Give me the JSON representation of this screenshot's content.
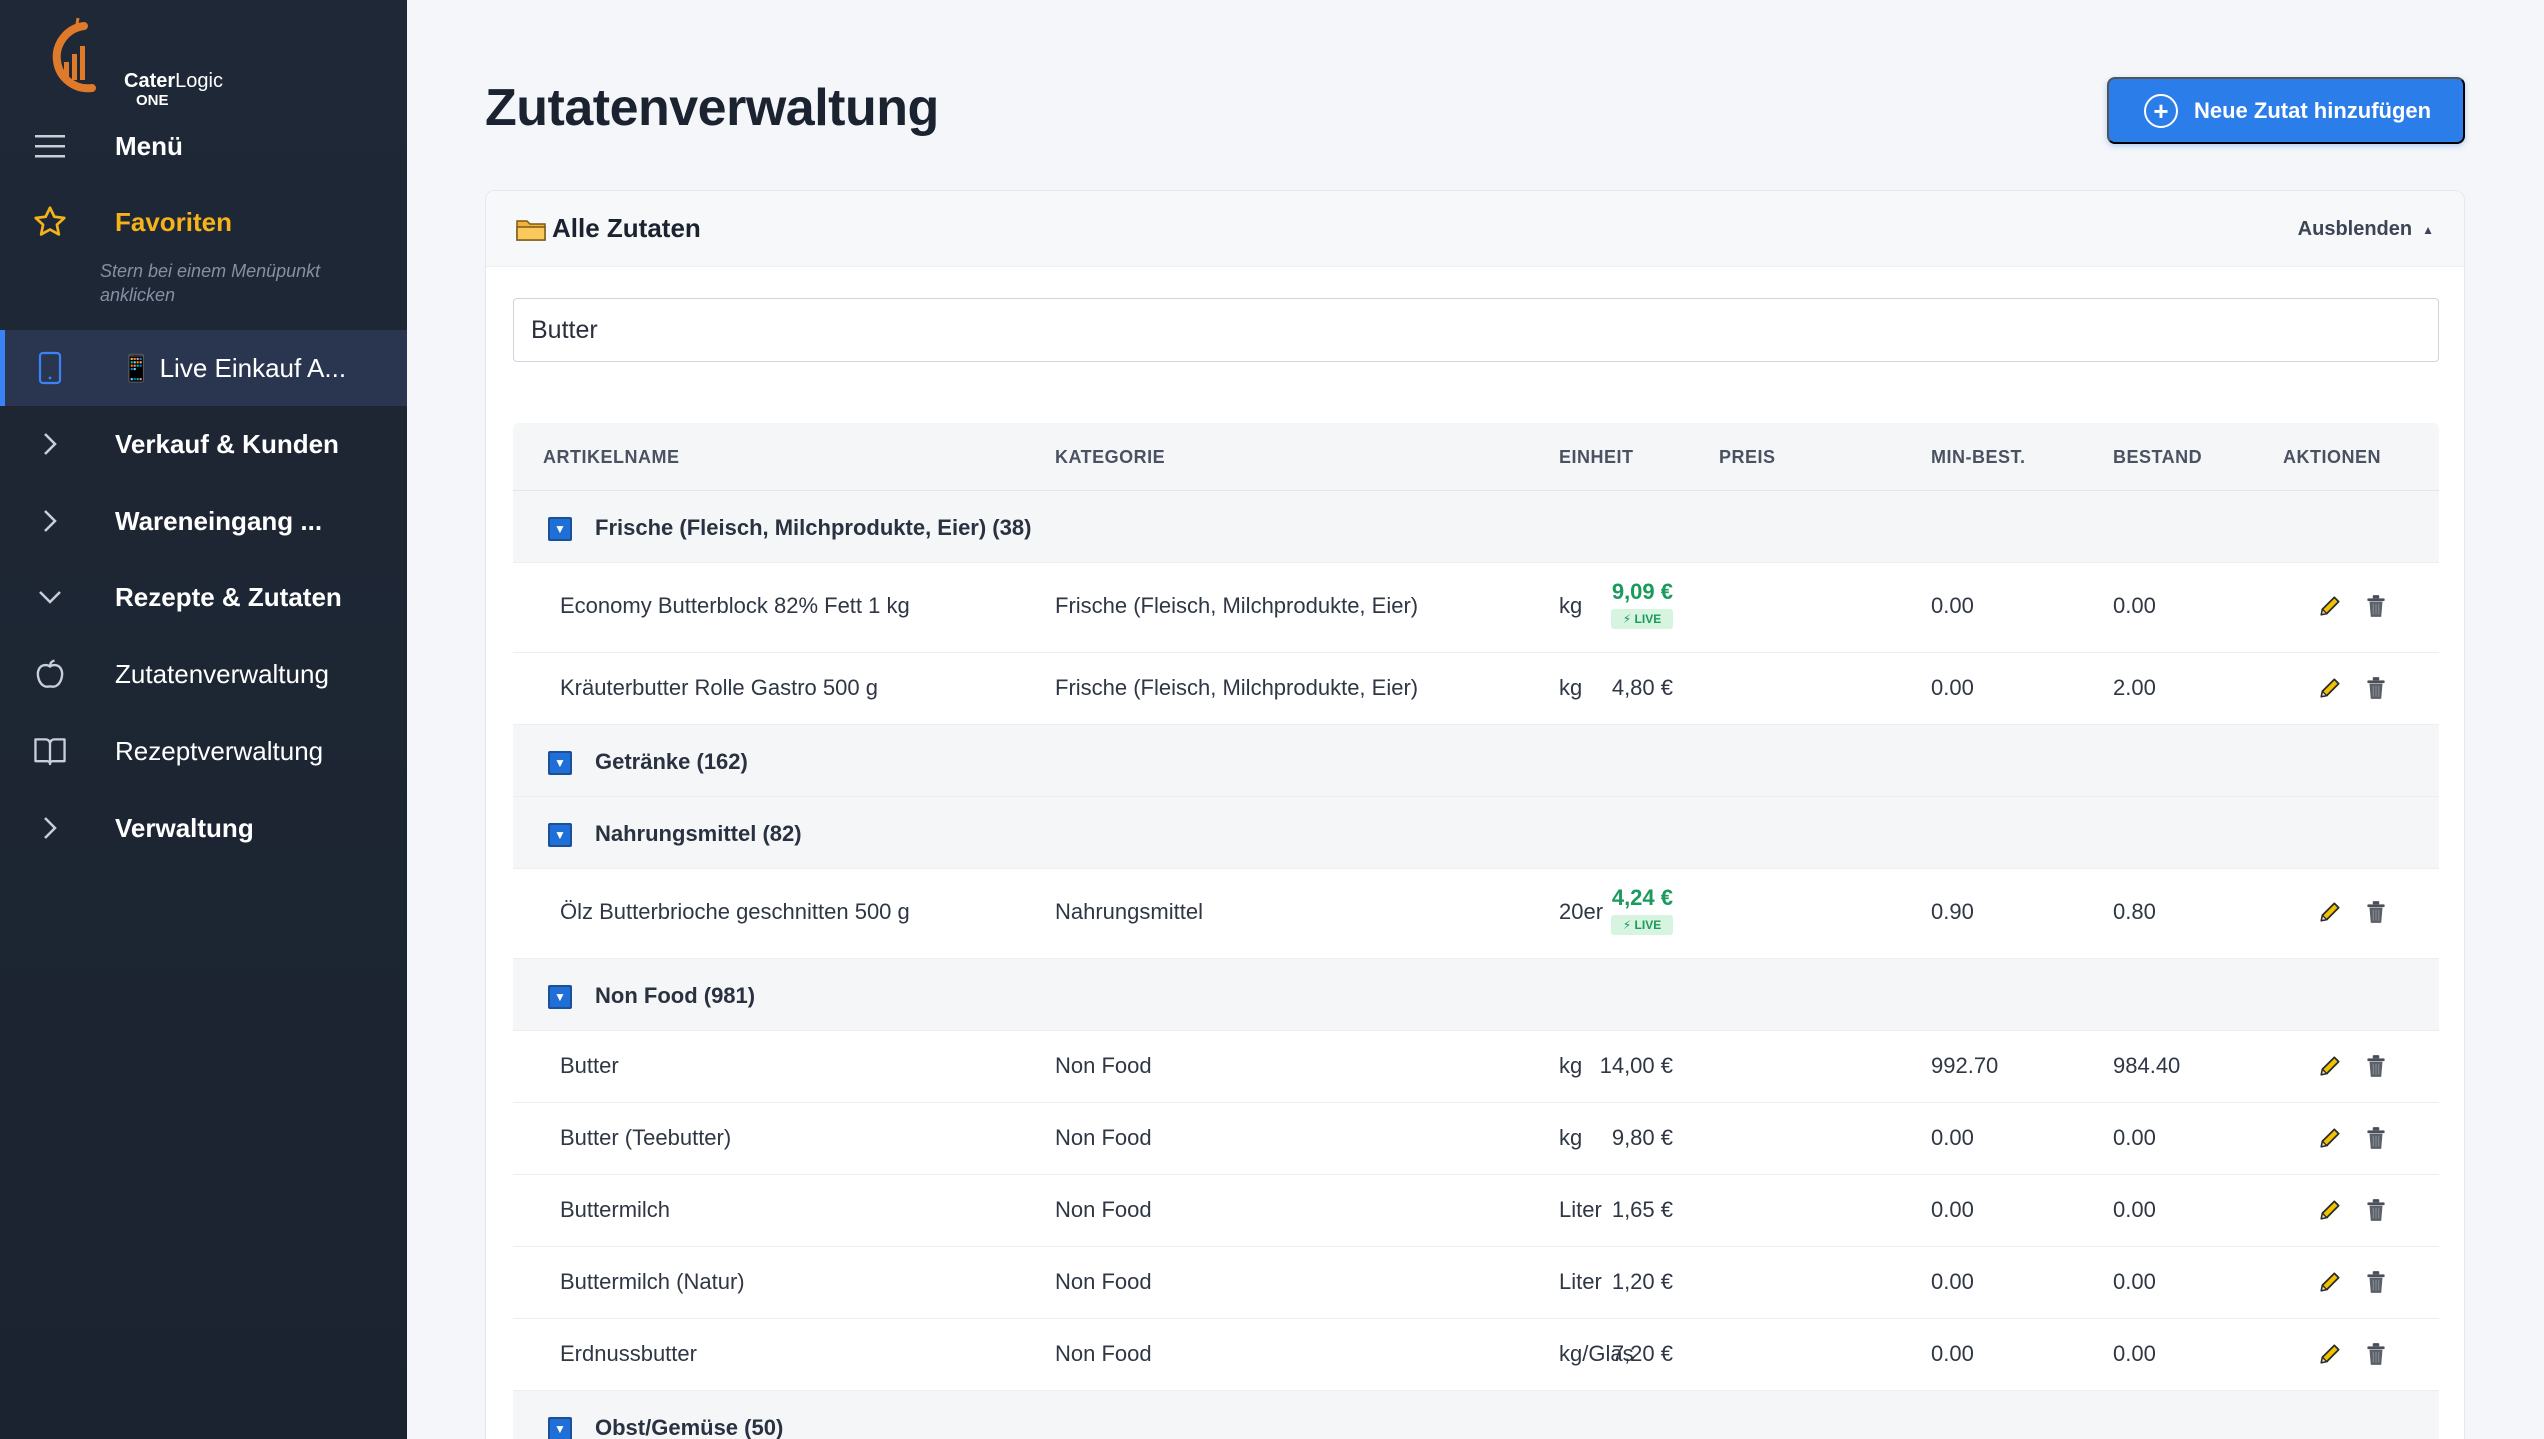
{
  "brand": {
    "name_bold": "Cater",
    "name_light": "Logic",
    "sub": "ONE"
  },
  "sidebar": {
    "menu_label": "Menü",
    "favorites_label": "Favoriten",
    "favorites_hint": "Stern bei einem Menüpunkt anklicken",
    "items": [
      {
        "label": "📱 Live Einkauf A...",
        "icon": "tablet-icon"
      },
      {
        "label": "Verkauf & Kunden",
        "icon": "chevron-right-icon"
      },
      {
        "label": "Wareneingang ...",
        "icon": "chevron-right-icon"
      },
      {
        "label": "Rezepte & Zutaten",
        "icon": "chevron-down-icon"
      },
      {
        "label": "Zutatenverwaltung",
        "icon": "apple-icon"
      },
      {
        "label": "Rezeptverwaltung",
        "icon": "book-icon"
      },
      {
        "label": "Verwaltung",
        "icon": "chevron-right-icon"
      }
    ]
  },
  "header": {
    "title": "Zutatenverwaltung",
    "add_button": "Neue Zutat hinzufügen"
  },
  "card": {
    "title": "Alle Zutaten",
    "toggle": "Ausblenden"
  },
  "search": {
    "value": "Butter"
  },
  "table": {
    "columns": [
      "ARTIKELNAME",
      "KATEGORIE",
      "EINHEIT",
      "PREIS",
      "MIN-BEST.",
      "BESTAND",
      "AKTIONEN"
    ],
    "live_label": "LIVE",
    "groups": [
      {
        "label": "Frische (Fleisch, Milchprodukte, Eier) (38)",
        "rows": [
          {
            "name": "Economy Butterblock 82% Fett 1 kg",
            "category": "Frische (Fleisch, Milchprodukte, Eier)",
            "unit": "kg",
            "price": "9,09 €",
            "live": true,
            "min": "0.00",
            "stock": "0.00"
          },
          {
            "name": "Kräuterbutter Rolle Gastro 500 g",
            "category": "Frische (Fleisch, Milchprodukte, Eier)",
            "unit": "kg",
            "price": "4,80 €",
            "live": false,
            "min": "0.00",
            "stock": "2.00"
          }
        ]
      },
      {
        "label": "Getränke (162)",
        "rows": []
      },
      {
        "label": "Nahrungsmittel (82)",
        "rows": [
          {
            "name": "Ölz Butterbrioche geschnitten 500 g",
            "category": "Nahrungsmittel",
            "unit": "20er",
            "price": "4,24 €",
            "live": true,
            "min": "0.90",
            "stock": "0.80"
          }
        ]
      },
      {
        "label": "Non Food (981)",
        "rows": [
          {
            "name": "Butter",
            "category": "Non Food",
            "unit": "kg",
            "price": "14,00 €",
            "live": false,
            "min": "992.70",
            "stock": "984.40"
          },
          {
            "name": "Butter (Teebutter)",
            "category": "Non Food",
            "unit": "kg",
            "price": "9,80 €",
            "live": false,
            "min": "0.00",
            "stock": "0.00"
          },
          {
            "name": "Buttermilch",
            "category": "Non Food",
            "unit": "Liter",
            "price": "1,65 €",
            "live": false,
            "min": "0.00",
            "stock": "0.00"
          },
          {
            "name": "Buttermilch (Natur)",
            "category": "Non Food",
            "unit": "Liter",
            "price": "1,20 €",
            "live": false,
            "min": "0.00",
            "stock": "0.00"
          },
          {
            "name": "Erdnussbutter",
            "category": "Non Food",
            "unit": "kg/Glas",
            "price": "7,20 €",
            "live": false,
            "min": "0.00",
            "stock": "0.00"
          }
        ]
      },
      {
        "label": "Obst/Gemüse (50)",
        "rows": []
      }
    ]
  },
  "colors": {
    "accent": "#2b7de9",
    "sidebar_bg": "#1f2836",
    "favorite": "#f6b21b",
    "live_green": "#1a9a5c"
  }
}
